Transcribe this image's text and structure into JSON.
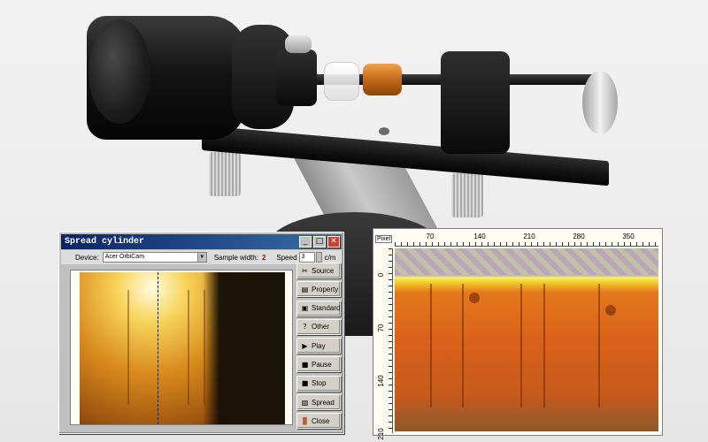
{
  "window": {
    "title": "Spread cylinder",
    "controls": {
      "minimize": "_",
      "maximize": "□",
      "close": "✕"
    }
  },
  "device_bar": {
    "device_label": "Device:",
    "device_value": "Acer OrbiCam",
    "sample_width_label": "Sample width:",
    "sample_width_value": "2",
    "speed_label": "Speed",
    "speed_value": "3",
    "speed_unit": "c/m"
  },
  "buttons": [
    {
      "label": "Source",
      "icon": "source-icon",
      "glyph": "✂"
    },
    {
      "label": "Property",
      "icon": "property-icon",
      "glyph": "▤"
    },
    {
      "label": "Standard",
      "icon": "standard-icon",
      "glyph": "▣"
    },
    {
      "label": "Other",
      "icon": "other-icon",
      "glyph": "?"
    },
    {
      "label": "Play",
      "icon": "play-icon",
      "glyph": "▶"
    },
    {
      "label": "Pause",
      "icon": "pause-icon",
      "glyph": "■"
    },
    {
      "label": "Stop",
      "icon": "stop-icon",
      "glyph": "■"
    },
    {
      "label": "Spread",
      "icon": "spread-icon",
      "glyph": "▧"
    },
    {
      "label": "Close",
      "icon": "close-door-icon",
      "glyph": "🚪"
    }
  ],
  "spread_view": {
    "unit_label": "Pixel",
    "top_ticks": [
      "70",
      "140",
      "210",
      "280",
      "350"
    ],
    "left_ticks": [
      "0",
      "70",
      "140",
      "210"
    ]
  },
  "colors": {
    "titlebar_start": "#0a246a",
    "titlebar_end": "#3a6ea5",
    "sample_width_value": "#c00000"
  }
}
